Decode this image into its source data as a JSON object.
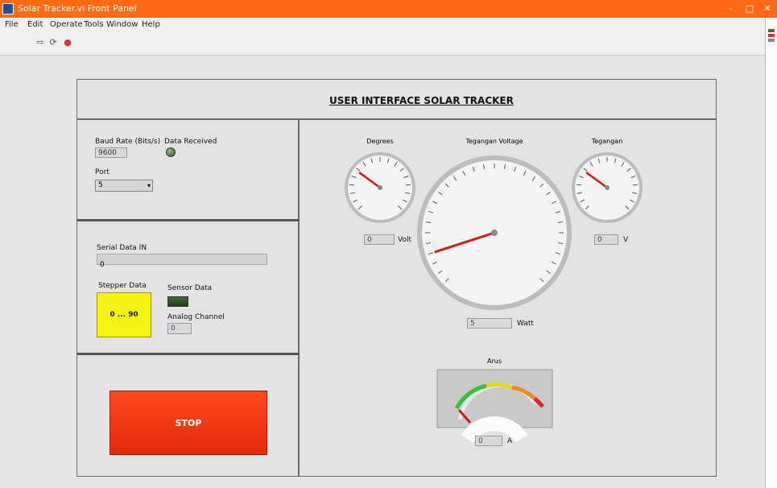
{
  "window": {
    "title": "Solar Tracker.vi Front Panel",
    "min": "–",
    "max": "□",
    "close": "✕"
  },
  "menu": [
    "File",
    "Edit",
    "Operate",
    "Tools",
    "Window",
    "Help"
  ],
  "header": {
    "title": "USER INTERFACE SOLAR TRACKER"
  },
  "settings": {
    "port_label": "Baud Rate (Bits/s)",
    "baud_value": "9600",
    "status_label": "Data Received",
    "com_label": "Port",
    "com_value": "5"
  },
  "monitor": {
    "read_label": "Serial Data IN",
    "read_value": "0",
    "motor_label": "Stepper Data",
    "motor_value": "0 ... 90",
    "led_label": "Sensor Data",
    "count_label": "Analog Channel",
    "count_value": "0"
  },
  "stop": {
    "label": "STOP"
  },
  "gauges": {
    "left": {
      "title": "Degrees",
      "value": "0",
      "unit": "Volt",
      "level": 0.3
    },
    "center": {
      "title": "Tegangan Voltage",
      "value": "5",
      "unit": "Watt",
      "level": 0.1
    },
    "right": {
      "title": "Tegangan",
      "value": "0",
      "unit": "V",
      "level": 0.3
    },
    "meter": {
      "title": "Arus",
      "value": "0",
      "unit": "A"
    }
  }
}
